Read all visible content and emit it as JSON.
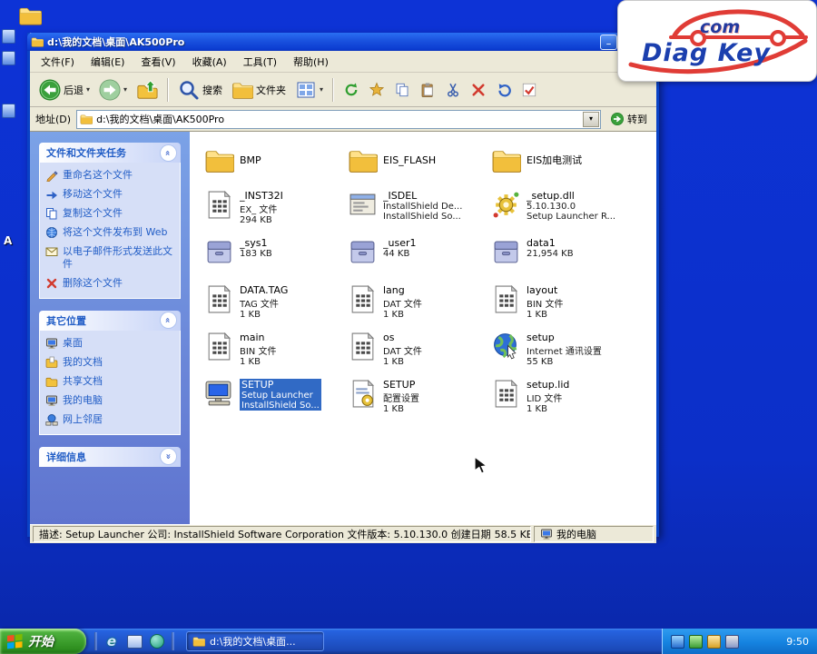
{
  "colors": {
    "desktop_blue": "#0c2fd6",
    "selection_blue": "#316ac5",
    "titlebar_blue": "#1b54e0",
    "taskbar_green": "#3f9e38",
    "logo_red": "#e03c36",
    "logo_blue": "#1b3fae"
  },
  "icons": {
    "dropdown": "▾",
    "chevron": "»",
    "min": "_",
    "max": "□",
    "close": "×",
    "ie_letter": "e"
  },
  "desktop": {
    "partial_label": "A"
  },
  "logo": {
    "com": "com",
    "brand": "Diag Key"
  },
  "window": {
    "title": "d:\\我的文档\\桌面\\AK500Pro",
    "menu": [
      "文件(F)",
      "编辑(E)",
      "查看(V)",
      "收藏(A)",
      "工具(T)",
      "帮助(H)"
    ],
    "toolbar": {
      "back": "后退",
      "search": "搜索",
      "folders": "文件夹"
    },
    "address": {
      "label": "地址(D)",
      "value": "d:\\我的文档\\桌面\\AK500Pro",
      "go": "转到"
    },
    "sidebar": {
      "panels": [
        {
          "title": "文件和文件夹任务",
          "items": [
            {
              "label": "重命名这个文件"
            },
            {
              "label": "移动这个文件"
            },
            {
              "label": "复制这个文件"
            },
            {
              "label": "将这个文件发布到 Web"
            },
            {
              "label": "以电子邮件形式发送此文件"
            },
            {
              "label": "删除这个文件"
            }
          ]
        },
        {
          "title": "其它位置",
          "items": [
            {
              "label": "桌面"
            },
            {
              "label": "我的文档"
            },
            {
              "label": "共享文档"
            },
            {
              "label": "我的电脑"
            },
            {
              "label": "网上邻居"
            }
          ]
        },
        {
          "title": "详细信息",
          "items": []
        }
      ]
    },
    "files": [
      {
        "name": "BMP",
        "line2": "",
        "line3": ""
      },
      {
        "name": "EIS_FLASH",
        "line2": "",
        "line3": ""
      },
      {
        "name": "EIS加电测试",
        "line2": "",
        "line3": ""
      },
      {
        "name": "_INST32I",
        "line2": "EX_ 文件",
        "line3": "294 KB"
      },
      {
        "name": "_ISDEL",
        "line2": "InstallShield De...",
        "line3": "InstallShield So..."
      },
      {
        "name": "_setup.dll",
        "line2": "5.10.130.0",
        "line3": "Setup Launcher R..."
      },
      {
        "name": "_sys1",
        "line2": "183 KB",
        "line3": ""
      },
      {
        "name": "_user1",
        "line2": "44 KB",
        "line3": ""
      },
      {
        "name": "data1",
        "line2": "21,954 KB",
        "line3": ""
      },
      {
        "name": "DATA.TAG",
        "line2": "TAG 文件",
        "line3": "1 KB"
      },
      {
        "name": "lang",
        "line2": "DAT 文件",
        "line3": "1 KB"
      },
      {
        "name": "layout",
        "line2": "BIN 文件",
        "line3": "1 KB"
      },
      {
        "name": "main",
        "line2": "BIN 文件",
        "line3": "1 KB"
      },
      {
        "name": "os",
        "line2": "DAT 文件",
        "line3": "1 KB"
      },
      {
        "name": "setup",
        "line2": "Internet 通讯设置",
        "line3": "55 KB"
      },
      {
        "name": "SETUP",
        "line2": "Setup Launcher",
        "line3": "InstallShield So..."
      },
      {
        "name": "SETUP",
        "line2": "配置设置",
        "line3": "1 KB"
      },
      {
        "name": "setup.lid",
        "line2": "LID 文件",
        "line3": "1 KB"
      }
    ],
    "status": {
      "description": "描述: Setup Launcher 公司: InstallShield Software Corporation 文件版本: 5.10.130.0 创建日期",
      "size": "58.5 KB",
      "location": "我的电脑"
    }
  },
  "taskbar": {
    "start": "开始",
    "task": "d:\\我的文档\\桌面...",
    "time": "9:50"
  }
}
